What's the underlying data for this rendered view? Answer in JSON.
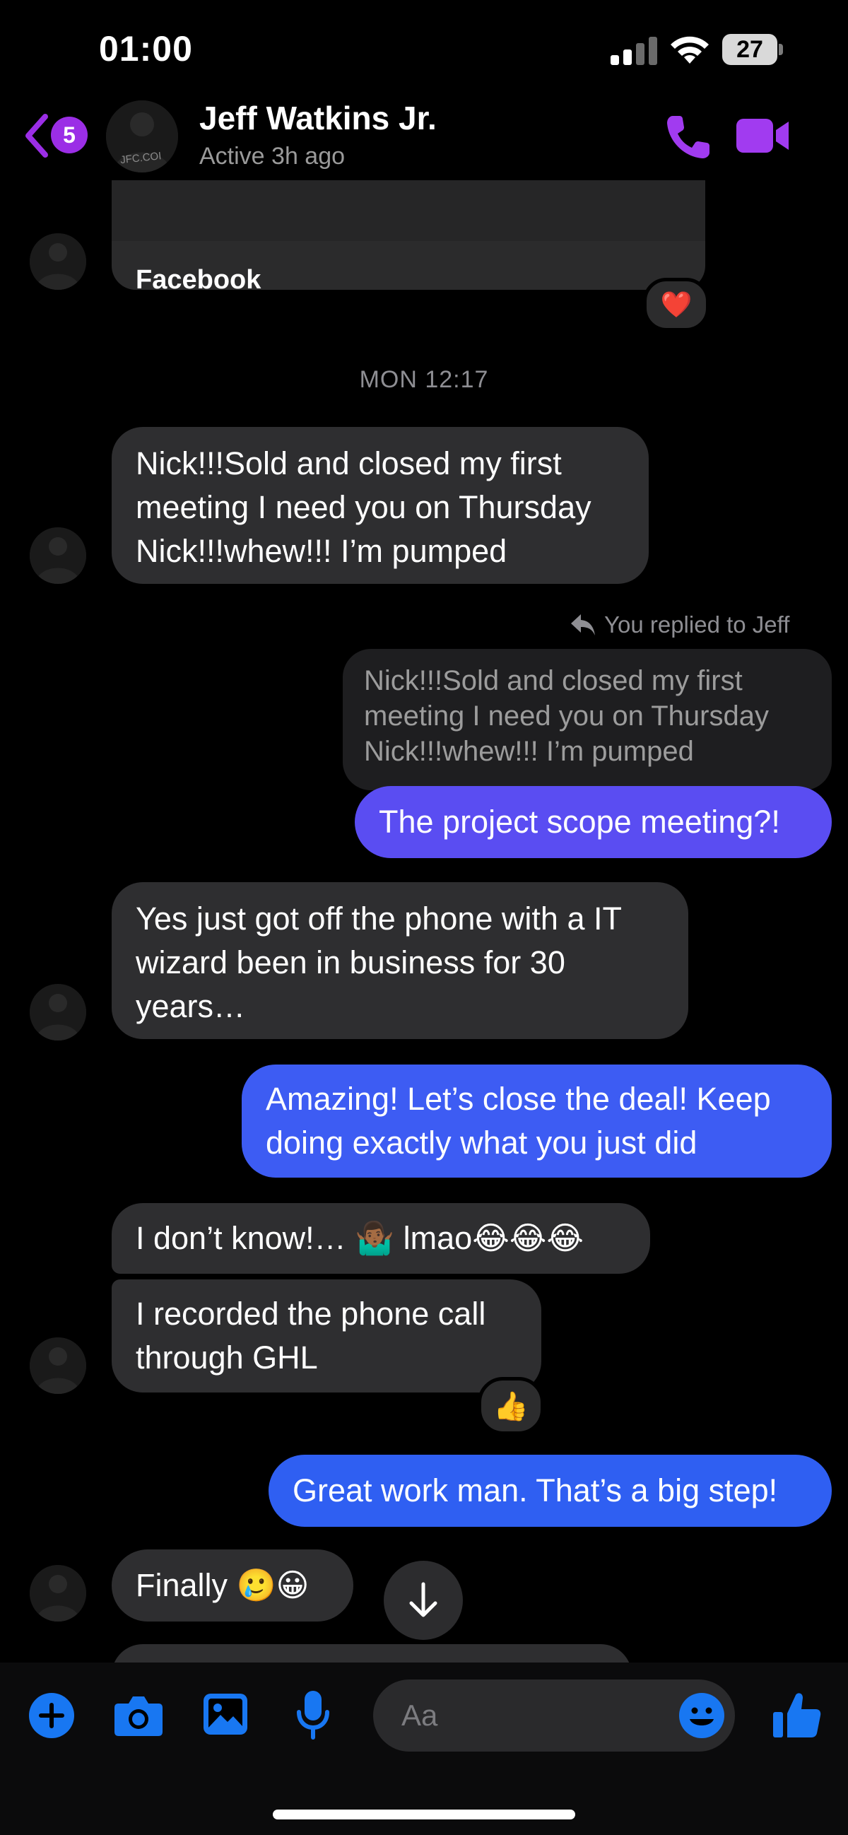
{
  "status_bar": {
    "time": "01:00",
    "battery": "27"
  },
  "header": {
    "back_badge": "5",
    "contact_name": "Jeff Watkins Jr.",
    "contact_status": "Active 3h ago",
    "avatar_text": "JFC.COI"
  },
  "link_card": {
    "title": "Facebook",
    "reaction": "❤️"
  },
  "timestamp": "MON 12:17",
  "messages": {
    "m1": {
      "lines": [
        "Nick!!!Sold and closed my first",
        "meeting I need you on Thursday",
        "Nick!!!whew!!! I’m pumped"
      ]
    },
    "reply_label": "You replied to Jeff",
    "reply_quote": {
      "lines": [
        "Nick!!!Sold and closed my first",
        "meeting I need you on Thursday",
        "Nick!!!whew!!! I’m pumped"
      ]
    },
    "m2": {
      "text": "The project scope meeting?!"
    },
    "m3": {
      "lines": [
        "Yes just got off the phone with a IT",
        "wizard been in business for 30",
        "years…"
      ]
    },
    "m4": {
      "lines": [
        "Amazing! Let’s close the deal! Keep",
        "doing exactly what you just did"
      ]
    },
    "m5": {
      "text": "I don’t know!… 🤷🏾‍♂️ lmao😂😂😂"
    },
    "m6": {
      "lines": [
        "I recorded the phone call",
        "through  GHL"
      ],
      "reaction": "👍"
    },
    "m7": {
      "text": "Great work man. That’s a big step!"
    },
    "m8": {
      "text": "Finally 🥲😀"
    }
  },
  "composer": {
    "placeholder": "Aa"
  },
  "colors": {
    "accent_purple": "#9b2ee6",
    "outgoing_purple": "#5a4df2",
    "outgoing_blue": "#2f5ff2",
    "incoming": "#2e2e30",
    "toolbar_blue": "#1877f2"
  },
  "icons": [
    "back-chevron-icon",
    "phone-icon",
    "video-camera-icon",
    "reply-arrow-icon",
    "arrow-down-icon",
    "plus-icon",
    "camera-icon",
    "image-icon",
    "microphone-icon",
    "smiley-icon",
    "thumbs-up-icon"
  ]
}
